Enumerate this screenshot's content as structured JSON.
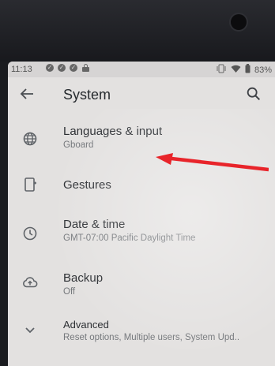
{
  "status_bar": {
    "time": "11:13",
    "notification_icons": [
      "check-circle",
      "check-circle",
      "check-circle",
      "bag"
    ],
    "battery": "83%"
  },
  "app_bar": {
    "title": "System"
  },
  "items": [
    {
      "title": "Languages & input",
      "subtitle": "Gboard",
      "icon": "globe-icon"
    },
    {
      "title": "Gestures",
      "subtitle": "",
      "icon": "phone-gesture-icon"
    },
    {
      "title": "Date & time",
      "subtitle": "GMT-07:00 Pacific Daylight Time",
      "icon": "clock-icon"
    },
    {
      "title": "Backup",
      "subtitle": "Off",
      "icon": "cloud-upload-icon"
    },
    {
      "title": "Advanced",
      "subtitle": "Reset options, Multiple users, System Upd..",
      "icon": "chevron-down-icon"
    }
  ],
  "colors": {
    "annotation_arrow": "#e8242a",
    "screen_bg": "#e3e1e0"
  }
}
